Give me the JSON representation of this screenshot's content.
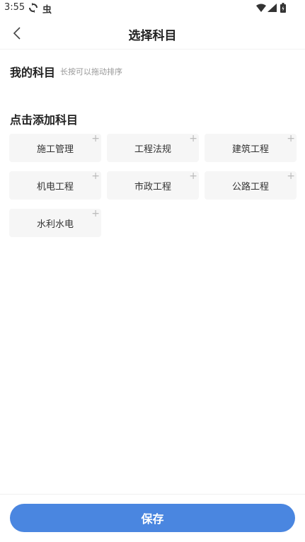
{
  "status_bar": {
    "time": "3:55",
    "bug_glyph": "虫"
  },
  "header": {
    "title": "选择科目",
    "back_icon": "chevron-left-icon"
  },
  "my_subjects": {
    "title": "我的科目",
    "hint": "长按可以拖动排序",
    "items": []
  },
  "add_subjects": {
    "title": "点击添加科目",
    "plus_glyph": "+",
    "items": [
      {
        "label": "施工管理"
      },
      {
        "label": "工程法规"
      },
      {
        "label": "建筑工程"
      },
      {
        "label": "机电工程"
      },
      {
        "label": "市政工程"
      },
      {
        "label": "公路工程"
      },
      {
        "label": "水利水电"
      }
    ]
  },
  "footer": {
    "save_label": "保存"
  },
  "colors": {
    "accent": "#4a86e0",
    "chip_bg": "#f6f6f6",
    "hint_text": "#999999"
  }
}
